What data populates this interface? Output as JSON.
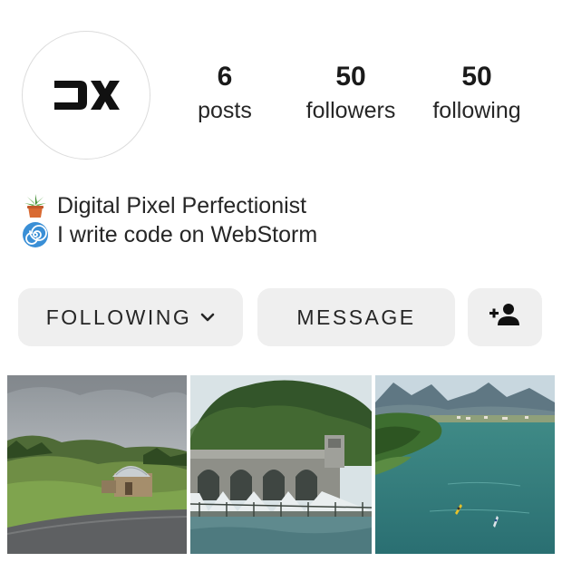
{
  "profile": {
    "avatar_logo_text": "DX",
    "stats": {
      "posts": {
        "count": "6",
        "label": "posts"
      },
      "followers": {
        "count": "50",
        "label": "followers"
      },
      "following": {
        "count": "50",
        "label": "following"
      }
    },
    "bio": [
      {
        "icon": "potted-plant-icon",
        "text": "Digital Pixel Perfectionist"
      },
      {
        "icon": "spiral-icon",
        "text": "I write code on WebStorm"
      }
    ]
  },
  "actions": {
    "following_label": "FOLLOWING",
    "message_label": "MESSAGE",
    "add_user_icon": "add-person-icon"
  },
  "grid": [
    {
      "scene": "hillside-observatory-photo"
    },
    {
      "scene": "dam-spillway-photo"
    },
    {
      "scene": "lake-kayaks-photo"
    }
  ],
  "colors": {
    "button_bg": "#efefef",
    "text": "#262626",
    "avatar_border": "#dcdcdc"
  }
}
